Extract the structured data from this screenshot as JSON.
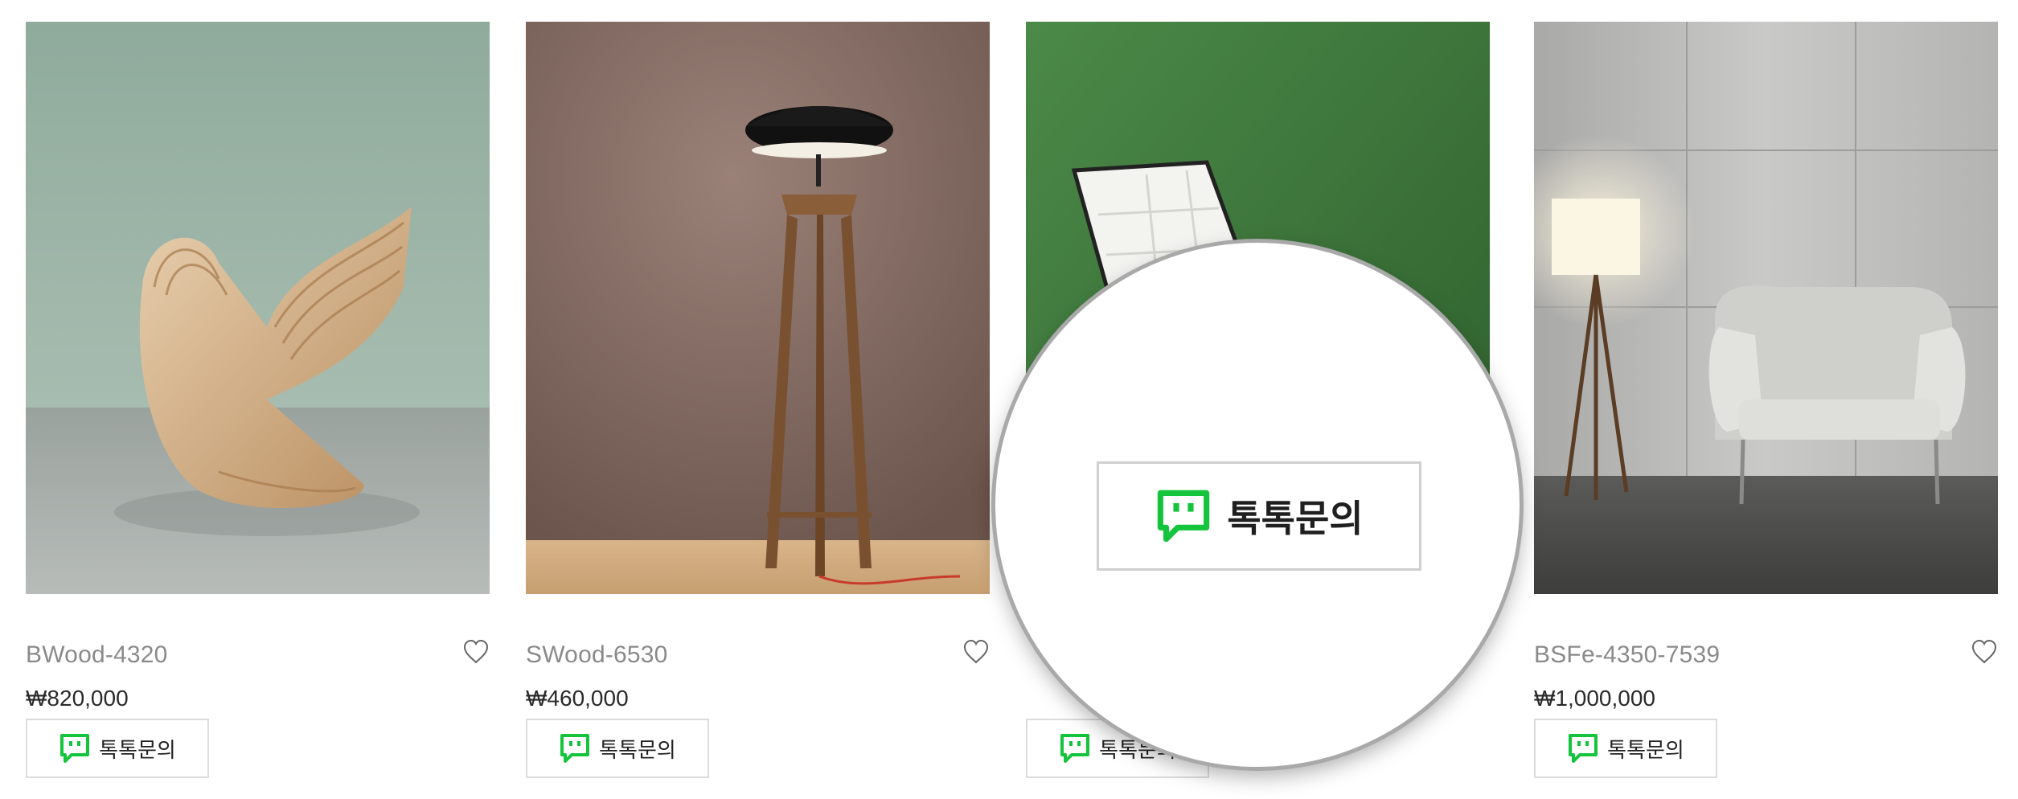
{
  "products": [
    {
      "name": "BWood-4320",
      "price": "₩820,000",
      "button_label": "톡톡문의",
      "image": "wooden-chair-photo",
      "wishlist_icon": "heart-icon"
    },
    {
      "name": "SWood-6530",
      "price": "₩460,000",
      "button_label": "톡톡문의",
      "image": "floor-lamp-photo",
      "wishlist_icon": "heart-icon"
    },
    {
      "name": "",
      "price": "",
      "button_label": "톡톡문의",
      "image": "white-leather-chair-photo",
      "wishlist_icon": "heart-icon"
    },
    {
      "name": "BSFe-4350-7539",
      "price": "₩1,000,000",
      "button_label": "톡톡문의",
      "image": "armchair-lamp-photo",
      "wishlist_icon": "heart-icon"
    }
  ],
  "magnifier": {
    "button_label": "톡톡문의",
    "icon": "talktalk-chat-icon"
  },
  "colors": {
    "talk_green": "#14c43c",
    "border": "#dcdcdc",
    "name_text": "#8a8a8a",
    "price_text": "#2a2a2a"
  }
}
